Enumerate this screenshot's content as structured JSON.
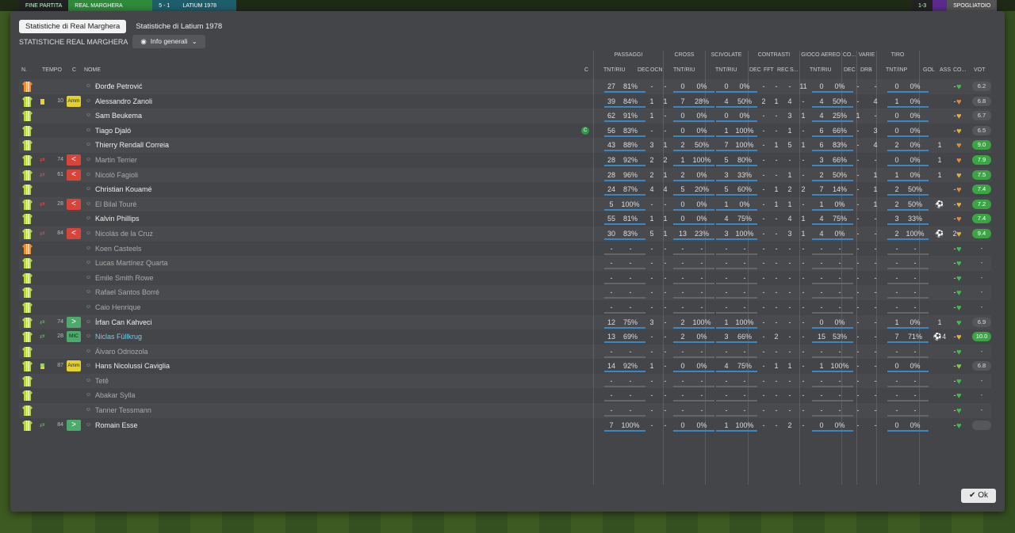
{
  "topbar": {
    "end_label": "FINE PARTITA",
    "home": "REAL MARGHERA",
    "score": "5 - 1",
    "away": "LATIUM 1978",
    "right_score": "1-3",
    "right_label": "SPOGLIATOIO"
  },
  "tabs": [
    "Statistiche di Real Marghera",
    "Statistiche di Latium 1978"
  ],
  "subtitle": "STATISTICHE REAL MARGHERA",
  "dropdown": "Info generali",
  "groups": {
    "passaggi": "PASSAGGI",
    "cross": "CROSS",
    "scivolate": "SCIVOLATE",
    "contrasti": "CONTRASTI",
    "aereo": "GIOCO AEREO",
    "co": "CO...",
    "varie": "VARIE",
    "tiro": "TIRO"
  },
  "cols": {
    "n": "N.",
    "tempo": "TEMPO",
    "c": "C",
    "nome": "NOME",
    "c2": "C",
    "pass": "TNT/RIU",
    "dec": "DEC",
    "ocn": "OCN",
    "cross": "TNT/RIU",
    "sciv": "TNT/RIU",
    "cdec": "DEC",
    "fft": "FFT",
    "rec": "REC",
    "s": "S...",
    "aereo": "TNT/RIU",
    "adec": "DEC",
    "drb": "DRB",
    "tiro": "TNT/INP",
    "gol": "GOL",
    "ass": "ASS",
    "co2": "CO...",
    "vot": "VOT"
  },
  "players": [
    {
      "gk": true,
      "name": "Đorđe Petrović",
      "card": false,
      "sub": "",
      "min": "",
      "badge": "",
      "badgec": "",
      "dim": false,
      "pass": "27",
      "passp": "81%",
      "dec": "-",
      "ocn": "-",
      "cr": "0",
      "crp": "0%",
      "sc": "0",
      "scp": "0%",
      "cdec": "-",
      "fft": "-",
      "rec": "-",
      "s": "11",
      "ae": "0",
      "aep": "0%",
      "adec": "-",
      "drb": "-",
      "ti": "0",
      "tip": "0%",
      "gol": "",
      "ass": "-",
      "heart": "#3fbf4a",
      "vot": "6.2",
      "votg": false
    },
    {
      "gk": false,
      "name": "Alessandro Zanoli",
      "card": true,
      "sub": "",
      "min": "10",
      "badge": "Amm",
      "badgec": "yellow",
      "dim": false,
      "pass": "39",
      "passp": "84%",
      "dec": "1",
      "ocn": "1",
      "cr": "7",
      "crp": "28%",
      "sc": "4",
      "scp": "50%",
      "cdec": "2",
      "fft": "1",
      "rec": "4",
      "s": "-",
      "ae": "4",
      "aep": "50%",
      "adec": "-",
      "drb": "4",
      "ti": "1",
      "tip": "0%",
      "gol": "",
      "ass": "-",
      "heart": "#e08a3a",
      "vot": "6.8",
      "votg": false
    },
    {
      "gk": false,
      "name": "Sam Beukema",
      "card": false,
      "sub": "",
      "min": "",
      "badge": "",
      "badgec": "",
      "dim": false,
      "pass": "62",
      "passp": "91%",
      "dec": "1",
      "ocn": "-",
      "cr": "0",
      "crp": "0%",
      "sc": "0",
      "scp": "0%",
      "cdec": "-",
      "fft": "-",
      "rec": "3",
      "s": "1",
      "ae": "4",
      "aep": "25%",
      "adec": "1",
      "drb": "-",
      "ti": "0",
      "tip": "0%",
      "gol": "",
      "ass": "-",
      "heart": "#e0b23a",
      "vot": "6.7",
      "votg": false
    },
    {
      "gk": false,
      "name": "Tiago Djaló",
      "card": false,
      "sub": "",
      "min": "",
      "badge": "",
      "badgec": "",
      "dim": false,
      "cap": true,
      "pass": "56",
      "passp": "83%",
      "dec": "-",
      "ocn": "-",
      "cr": "0",
      "crp": "0%",
      "sc": "1",
      "scp": "100%",
      "cdec": "-",
      "fft": "-",
      "rec": "1",
      "s": "-",
      "ae": "6",
      "aep": "66%",
      "adec": "-",
      "drb": "3",
      "ti": "0",
      "tip": "0%",
      "gol": "",
      "ass": "-",
      "heart": "#e0b23a",
      "vot": "6.5",
      "votg": false
    },
    {
      "gk": false,
      "name": "Thierry Rendall Correia",
      "card": false,
      "sub": "",
      "min": "",
      "badge": "",
      "badgec": "",
      "dim": false,
      "pass": "43",
      "passp": "88%",
      "dec": "3",
      "ocn": "1",
      "cr": "2",
      "crp": "50%",
      "sc": "7",
      "scp": "100%",
      "cdec": "-",
      "fft": "1",
      "rec": "5",
      "s": "1",
      "ae": "6",
      "aep": "83%",
      "adec": "-",
      "drb": "4",
      "ti": "2",
      "tip": "0%",
      "gol": "1",
      "ass": "",
      "heart": "#e08a3a",
      "vot": "9.0",
      "votg": true
    },
    {
      "gk": false,
      "name": "Martin Terrier",
      "card": false,
      "sub": "out",
      "min": "74",
      "badge": "<",
      "badgec": "red",
      "dim": true,
      "pass": "28",
      "passp": "92%",
      "dec": "2",
      "ocn": "2",
      "cr": "1",
      "crp": "100%",
      "sc": "5",
      "scp": "80%",
      "cdec": "-",
      "fft": "-",
      "rec": "-",
      "s": "-",
      "ae": "3",
      "aep": "66%",
      "adec": "-",
      "drb": "-",
      "ti": "0",
      "tip": "0%",
      "gol": "1",
      "ass": "",
      "heart": "#e08a3a",
      "vot": "7.9",
      "votg": true
    },
    {
      "gk": false,
      "name": "Nicolò Fagioli",
      "card": false,
      "sub": "out",
      "min": "61",
      "badge": "<",
      "badgec": "red",
      "dim": true,
      "pass": "28",
      "passp": "96%",
      "dec": "2",
      "ocn": "1",
      "cr": "2",
      "crp": "0%",
      "sc": "3",
      "scp": "33%",
      "cdec": "-",
      "fft": "-",
      "rec": "1",
      "s": "-",
      "ae": "2",
      "aep": "50%",
      "adec": "-",
      "drb": "1",
      "ti": "1",
      "tip": "0%",
      "gol": "1",
      "ass": "",
      "heart": "#e0b23a",
      "vot": "7.5",
      "votg": true
    },
    {
      "gk": false,
      "name": "Christian Kouamé",
      "card": false,
      "sub": "",
      "min": "",
      "badge": "",
      "badgec": "",
      "dim": false,
      "pass": "24",
      "passp": "87%",
      "dec": "4",
      "ocn": "4",
      "cr": "5",
      "crp": "20%",
      "sc": "5",
      "scp": "60%",
      "cdec": "-",
      "fft": "1",
      "rec": "2",
      "s": "2",
      "ae": "7",
      "aep": "14%",
      "adec": "-",
      "drb": "1",
      "ti": "2",
      "tip": "50%",
      "gol": "",
      "ass": "-",
      "heart": "#e08a3a",
      "vot": "7.4",
      "votg": true
    },
    {
      "gk": false,
      "name": "El Bilal Touré",
      "card": false,
      "sub": "out",
      "min": "28",
      "badge": "<",
      "badgec": "red",
      "dim": true,
      "pass": "5",
      "passp": "100%",
      "dec": "-",
      "ocn": "-",
      "cr": "0",
      "crp": "0%",
      "sc": "1",
      "scp": "0%",
      "cdec": "-",
      "fft": "1",
      "rec": "1",
      "s": "-",
      "ae": "1",
      "aep": "0%",
      "adec": "-",
      "drb": "1",
      "ti": "2",
      "tip": "50%",
      "gol": "⚽",
      "ass": "-",
      "heart": "#e0b23a",
      "vot": "7.2",
      "votg": true
    },
    {
      "gk": false,
      "name": "Kalvin Phillips",
      "card": false,
      "sub": "",
      "min": "",
      "badge": "",
      "badgec": "",
      "dim": false,
      "pass": "55",
      "passp": "81%",
      "dec": "1",
      "ocn": "1",
      "cr": "0",
      "crp": "0%",
      "sc": "4",
      "scp": "75%",
      "cdec": "-",
      "fft": "-",
      "rec": "4",
      "s": "1",
      "ae": "4",
      "aep": "75%",
      "adec": "-",
      "drb": "-",
      "ti": "3",
      "tip": "33%",
      "gol": "",
      "ass": "-",
      "heart": "#e08a3a",
      "vot": "7.4",
      "votg": true
    },
    {
      "gk": false,
      "name": "Nicolás de la Cruz",
      "card": false,
      "sub": "out",
      "min": "84",
      "badge": "<",
      "badgec": "red",
      "dim": true,
      "pass": "30",
      "passp": "83%",
      "dec": "5",
      "ocn": "1",
      "cr": "13",
      "crp": "23%",
      "sc": "3",
      "scp": "100%",
      "cdec": "-",
      "fft": "-",
      "rec": "3",
      "s": "1",
      "ae": "4",
      "aep": "0%",
      "adec": "-",
      "drb": "-",
      "ti": "2",
      "tip": "100%",
      "gol": "⚽",
      "ass": "2",
      "heart": "#e0b23a",
      "vot": "9.4",
      "votg": true
    },
    {
      "gk": true,
      "name": "Koen Casteels",
      "card": false,
      "sub": "",
      "min": "",
      "badge": "",
      "badgec": "",
      "dim": true,
      "empty": true,
      "heart": "#3fbf4a"
    },
    {
      "gk": false,
      "name": "Lucas Martínez Quarta",
      "card": false,
      "sub": "",
      "min": "",
      "badge": "",
      "badgec": "",
      "dim": true,
      "empty": true,
      "heart": "#3fbf4a"
    },
    {
      "gk": false,
      "name": "Emile Smith Rowe",
      "card": false,
      "sub": "",
      "min": "",
      "badge": "",
      "badgec": "",
      "dim": true,
      "empty": true,
      "heart": "#3fbf4a"
    },
    {
      "gk": false,
      "name": "Rafael Santos Borré",
      "card": false,
      "sub": "",
      "min": "",
      "badge": "",
      "badgec": "",
      "dim": true,
      "empty": true,
      "heart": "#3fbf4a"
    },
    {
      "gk": false,
      "name": "Caio Henrique",
      "card": false,
      "sub": "",
      "min": "",
      "badge": "",
      "badgec": "",
      "dim": true,
      "empty": true,
      "heart": "#3fbf4a"
    },
    {
      "gk": false,
      "name": "İrfan Can Kahveci",
      "card": false,
      "sub": "in",
      "min": "74",
      "badge": ">",
      "badgec": "green",
      "dim": false,
      "pass": "12",
      "passp": "75%",
      "dec": "3",
      "ocn": "-",
      "cr": "2",
      "crp": "100%",
      "sc": "1",
      "scp": "100%",
      "cdec": "-",
      "fft": "-",
      "rec": "-",
      "s": "-",
      "ae": "0",
      "aep": "0%",
      "adec": "-",
      "drb": "-",
      "ti": "1",
      "tip": "0%",
      "gol": "1",
      "ass": "",
      "heart": "#3fbf4a",
      "vot": "6.9",
      "votg": false
    },
    {
      "gk": false,
      "name": "Niclas Füllkrug",
      "card": false,
      "sub": "in",
      "min": "28",
      "badge": "MIC",
      "badgec": "teal",
      "dim": false,
      "hl": true,
      "pass": "13",
      "passp": "69%",
      "dec": "-",
      "ocn": "-",
      "cr": "2",
      "crp": "0%",
      "sc": "3",
      "scp": "66%",
      "cdec": "-",
      "fft": "2",
      "rec": "-",
      "s": "-",
      "ae": "15",
      "aep": "53%",
      "adec": "-",
      "drb": "-",
      "ti": "7",
      "tip": "71%",
      "gol": "⚽4",
      "ass": "-",
      "heart": "#e0b23a",
      "vot": "10.0",
      "votg": true
    },
    {
      "gk": false,
      "name": "Álvaro Odriozola",
      "card": false,
      "sub": "",
      "min": "",
      "badge": "",
      "badgec": "",
      "dim": true,
      "empty": true,
      "heart": "#3fbf4a"
    },
    {
      "gk": false,
      "name": "Hans Nicolussi Caviglia",
      "card": true,
      "sub": "in",
      "min": "87",
      "badge": "Amm",
      "badgec": "yellow",
      "dim": false,
      "pass": "14",
      "passp": "92%",
      "dec": "1",
      "ocn": "-",
      "cr": "0",
      "crp": "0%",
      "sc": "4",
      "scp": "75%",
      "cdec": "-",
      "fft": "1",
      "rec": "1",
      "s": "-",
      "ae": "1",
      "aep": "100%",
      "adec": "-",
      "drb": "-",
      "ti": "0",
      "tip": "0%",
      "gol": "",
      "ass": "-",
      "heart": "#7ccf3a",
      "vot": "6.8",
      "votg": false
    },
    {
      "gk": false,
      "name": "Tetê",
      "card": false,
      "sub": "",
      "min": "",
      "badge": "",
      "badgec": "",
      "dim": true,
      "empty": true,
      "heart": "#3fbf4a"
    },
    {
      "gk": false,
      "name": "Abakar Sylla",
      "card": false,
      "sub": "",
      "min": "",
      "badge": "",
      "badgec": "",
      "dim": true,
      "empty": true,
      "heart": "#3fbf4a"
    },
    {
      "gk": false,
      "name": "Tanner Tessmann",
      "card": false,
      "sub": "",
      "min": "",
      "badge": "",
      "badgec": "",
      "dim": true,
      "empty": true,
      "heart": "#3fbf4a"
    },
    {
      "gk": false,
      "name": "Romain Esse",
      "card": false,
      "sub": "in",
      "min": "84",
      "badge": ">",
      "badgec": "green",
      "dim": false,
      "pass": "7",
      "passp": "100%",
      "dec": "-",
      "ocn": "-",
      "cr": "0",
      "crp": "0%",
      "sc": "1",
      "scp": "100%",
      "cdec": "-",
      "fft": "-",
      "rec": "2",
      "s": "-",
      "ae": "0",
      "aep": "0%",
      "adec": "-",
      "drb": "-",
      "ti": "0",
      "tip": "0%",
      "gol": "",
      "ass": "-",
      "heart": "#3fbf4a",
      "vot": "",
      "votg": false
    }
  ],
  "ok": "Ok"
}
